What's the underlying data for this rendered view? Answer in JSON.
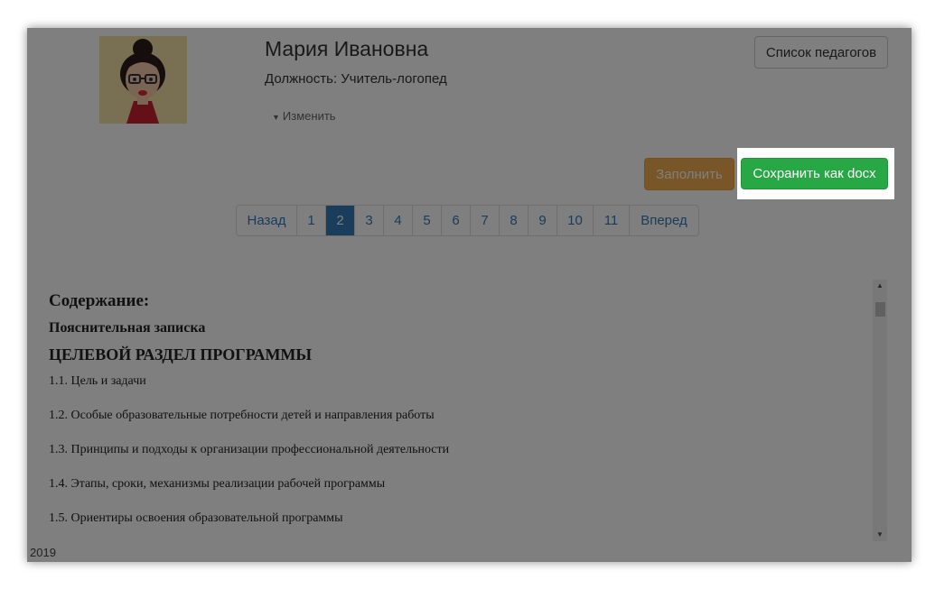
{
  "profile": {
    "name": "Мария Ивановна",
    "position": "Должность: Учитель-логопед",
    "change_label": "Изменить"
  },
  "header": {
    "teachers_list_button": "Список педагогов"
  },
  "actions": {
    "fill_button": "Заполнить",
    "save_docx_button": "Сохранить как docx"
  },
  "pagination": {
    "prev": "Назад",
    "pages": [
      "1",
      "2",
      "3",
      "4",
      "5",
      "6",
      "7",
      "8",
      "9",
      "10",
      "11"
    ],
    "active_page": "2",
    "next": "Вперед"
  },
  "document": {
    "contents_heading": "Содержание:",
    "explanatory_note": "Пояснительная записка",
    "target_section": "ЦЕЛЕВОЙ РАЗДЕЛ ПРОГРАММЫ",
    "items": [
      "1.1. Цель и задачи",
      "1.2. Особые образовательные потребности детей и направления работы",
      "1.3. Принципы и подходы к организации профессиональной деятельности",
      "1.4. Этапы, сроки, механизмы реализации рабочей программы",
      "1.5. Ориентиры освоения образовательной программы"
    ]
  },
  "footer": {
    "year": "2019"
  },
  "colors": {
    "fill_button": "#f0ad4e",
    "save_button": "#28a745",
    "link": "#337ab7",
    "overlay": "rgba(0,0,0,0.5)"
  }
}
